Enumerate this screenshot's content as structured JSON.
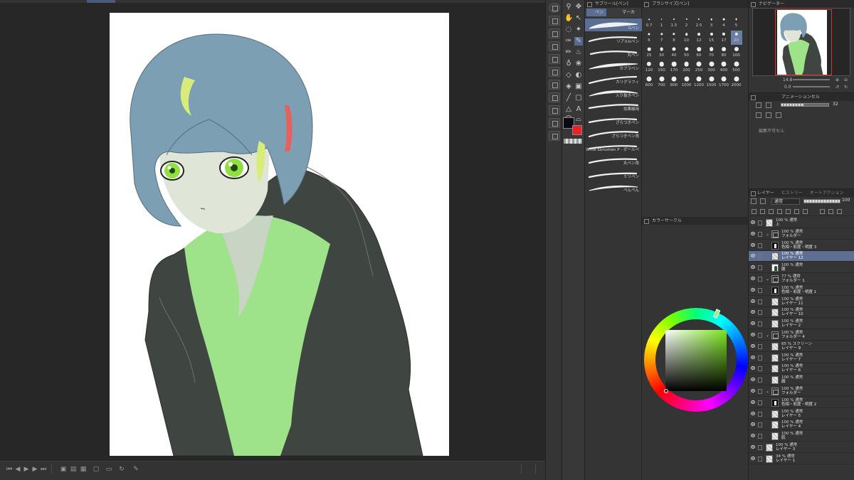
{
  "subtool": {
    "header": "サブツール[ペン]",
    "tab_pen": "ペン",
    "tab_marker": "マーカー",
    "brushes": [
      {
        "name": "Gペン",
        "selected": true
      },
      {
        "name": "リアルGペン",
        "selected": false
      },
      {
        "name": "丸ペン",
        "selected": false
      },
      {
        "name": "カブラペン",
        "selected": false
      },
      {
        "name": "カリグラフィ",
        "selected": false
      },
      {
        "name": "入り抜きペン",
        "selected": false
      },
      {
        "name": "効果線用",
        "selected": false
      },
      {
        "name": "ざらつきペン",
        "selected": false
      },
      {
        "name": "ざらつきペン改",
        "selected": false
      },
      {
        "name": "Write Ebrushen P - ボールペ",
        "selected": false
      },
      {
        "name": "丸ペン改",
        "selected": false
      },
      {
        "name": "ミリペン",
        "selected": false
      },
      {
        "name": "ぺんぺん",
        "selected": false
      }
    ]
  },
  "brushsize": {
    "header": "ブラシサイズ[ペン]",
    "sizes": [
      "0.7",
      "1",
      "1.5",
      "2",
      "2.5",
      "3",
      "4",
      "5",
      "6",
      "7",
      "8",
      "10",
      "12",
      "15",
      "17",
      "20",
      "25",
      "30",
      "40",
      "50",
      "60",
      "70",
      "80",
      "100",
      "120",
      "150",
      "170",
      "200",
      "250",
      "300",
      "400",
      "500",
      "600",
      "700",
      "800",
      "1000",
      "1200",
      "1500",
      "1700",
      "2000"
    ],
    "selected": "20"
  },
  "colorcircle": {
    "header": "カラーサークル"
  },
  "navigator": {
    "header": "ナビゲーター",
    "zoom": "14.8",
    "angle": "0.0"
  },
  "animation": {
    "header": "アニメーションセル",
    "frame_value": "32",
    "message": "編集不可セル"
  },
  "layers": {
    "tab_layer": "レイヤー",
    "tab_history": "ヒストリー",
    "tab_autoaction": "オートアクション",
    "blend_mode": "通常",
    "opacity": "100",
    "rows": [
      {
        "line1": "100 % 通常",
        "line2": "上",
        "type": "layer",
        "indent": 0,
        "selected": false
      },
      {
        "line1": "100 % 通常",
        "line2": "フォルダー",
        "type": "folder",
        "indent": 0,
        "selected": false
      },
      {
        "line1": "100 % 通常",
        "line2": "色相・彩度・明度 3",
        "type": "tone",
        "indent": 1,
        "selected": false
      },
      {
        "line1": "100 % 通常",
        "line2": "レイヤー 12",
        "type": "layer",
        "indent": 1,
        "selected": true
      },
      {
        "line1": "100 % 通常",
        "line2": "服",
        "type": "fig",
        "indent": 1,
        "selected": false
      },
      {
        "line1": "77 % 通常",
        "line2": "フォルダー 1",
        "type": "folder",
        "indent": 0,
        "selected": false
      },
      {
        "line1": "100 % 通常",
        "line2": "色相・彩度・明度 1",
        "type": "tone",
        "indent": 1,
        "selected": false
      },
      {
        "line1": "100 % 通常",
        "line2": "レイヤー 11",
        "type": "layer",
        "indent": 1,
        "selected": false
      },
      {
        "line1": "100 % 通常",
        "line2": "レイヤー 10",
        "type": "layer",
        "indent": 1,
        "selected": false
      },
      {
        "line1": "100 % 通常",
        "line2": "レイヤー 2",
        "type": "layer",
        "indent": 1,
        "selected": false
      },
      {
        "line1": "100 % 通常",
        "line2": "フォルダー 4",
        "type": "folder",
        "indent": 0,
        "selected": false
      },
      {
        "line1": "85 % スクリーン",
        "line2": "レイヤー 9",
        "type": "layer",
        "indent": 1,
        "selected": false
      },
      {
        "line1": "100 % 通常",
        "line2": "レイヤー 7",
        "type": "layer",
        "indent": 1,
        "selected": false
      },
      {
        "line1": "100 % 通常",
        "line2": "レイヤー 6",
        "type": "layer",
        "indent": 1,
        "selected": false
      },
      {
        "line1": "100 % 通常",
        "line2": "顔",
        "type": "layer",
        "indent": 1,
        "selected": false
      },
      {
        "line1": "100 % 通常",
        "line2": "フォルダー",
        "type": "folder",
        "indent": 0,
        "selected": false
      },
      {
        "line1": "100 % 通常",
        "line2": "色相・彩度・明度 2",
        "type": "tone",
        "indent": 1,
        "selected": false
      },
      {
        "line1": "100 % 通常",
        "line2": "レイヤー 5",
        "type": "layer",
        "indent": 1,
        "selected": false
      },
      {
        "line1": "100 % 通常",
        "line2": "レイヤー 4",
        "type": "layer",
        "indent": 1,
        "selected": false
      },
      {
        "line1": "100 % 通常",
        "line2": "肌",
        "type": "layer",
        "indent": 1,
        "selected": false
      },
      {
        "line1": "100 % 通常",
        "line2": "レイヤー 3",
        "type": "layer",
        "indent": 0,
        "selected": false
      },
      {
        "line1": "34 % 通常",
        "line2": "レイヤー 1",
        "type": "layer",
        "indent": 0,
        "selected": false
      }
    ]
  },
  "colors": {
    "main_color": "#0a0a14",
    "sub_color": "#e22222",
    "accent": "#5a6e93",
    "hair": "#7d9fb3",
    "eyes": "#8fe040",
    "shirt": "#9ee28a",
    "jacket": "#3f4540"
  },
  "tool_icons": [
    "zoom-icon",
    "move-icon",
    "lasso-select-icon",
    "eyedropper-icon",
    "pen-icon",
    "pencil-icon",
    "brush-icon",
    "airbrush-icon",
    "eraser-icon",
    "fill-icon",
    "gradient-icon",
    "shape-icon",
    "frame-icon",
    "text-icon",
    "balloon-icon",
    "line-icon"
  ]
}
